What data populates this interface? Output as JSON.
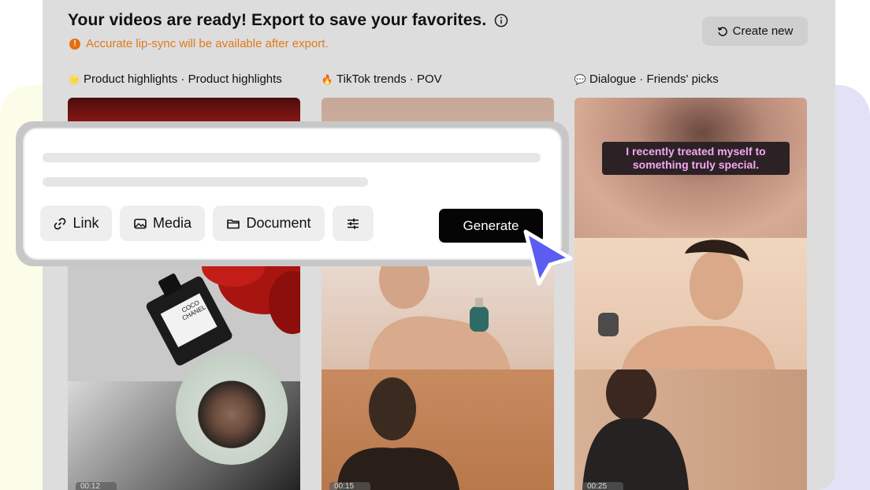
{
  "header": {
    "title": "Your videos are ready! Export to save your favorites.",
    "warning": "Accurate lip-sync will be available after export.",
    "create_new_label": "Create new"
  },
  "columns": [
    {
      "emoji": "🌟",
      "label": "Product highlights · Product highlights",
      "time": "00:12"
    },
    {
      "emoji": "🔥",
      "label": "TikTok trends · POV",
      "time": "00:15"
    },
    {
      "emoji": "💬",
      "label": "Dialogue · Friends' picks",
      "time": "00:25"
    }
  ],
  "caption_text": "I recently treated myself to something truly special.",
  "bottle_label": "COCO CHANEL",
  "prompt": {
    "tools": [
      "Link",
      "Media",
      "Document"
    ],
    "generate_label": "Generate"
  },
  "colors": {
    "panel_bg": "#dddddd",
    "warning": "#e07a1a",
    "generate_bg": "#050505",
    "cursor": "#5b5cf0",
    "caption_text": "#f4a8f2"
  }
}
